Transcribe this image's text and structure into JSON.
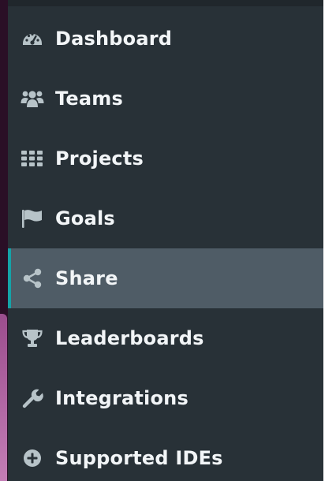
{
  "sidebar": {
    "items": [
      {
        "label": "Dashboard",
        "icon": "dashboard-icon"
      },
      {
        "label": "Teams",
        "icon": "users-icon"
      },
      {
        "label": "Projects",
        "icon": "grid-icon"
      },
      {
        "label": "Goals",
        "icon": "flag-icon"
      },
      {
        "label": "Share",
        "icon": "share-icon",
        "active": true
      },
      {
        "label": "Leaderboards",
        "icon": "trophy-icon"
      },
      {
        "label": "Integrations",
        "icon": "wrench-icon"
      },
      {
        "label": "Supported IDEs",
        "icon": "plus-circle-icon"
      }
    ]
  },
  "colors": {
    "sidebar_bg": "#283137",
    "active_bg": "#4f5c66",
    "active_accent": "#15a3a8",
    "icon": "#b7c3c8",
    "text": "#f2f5f7"
  }
}
